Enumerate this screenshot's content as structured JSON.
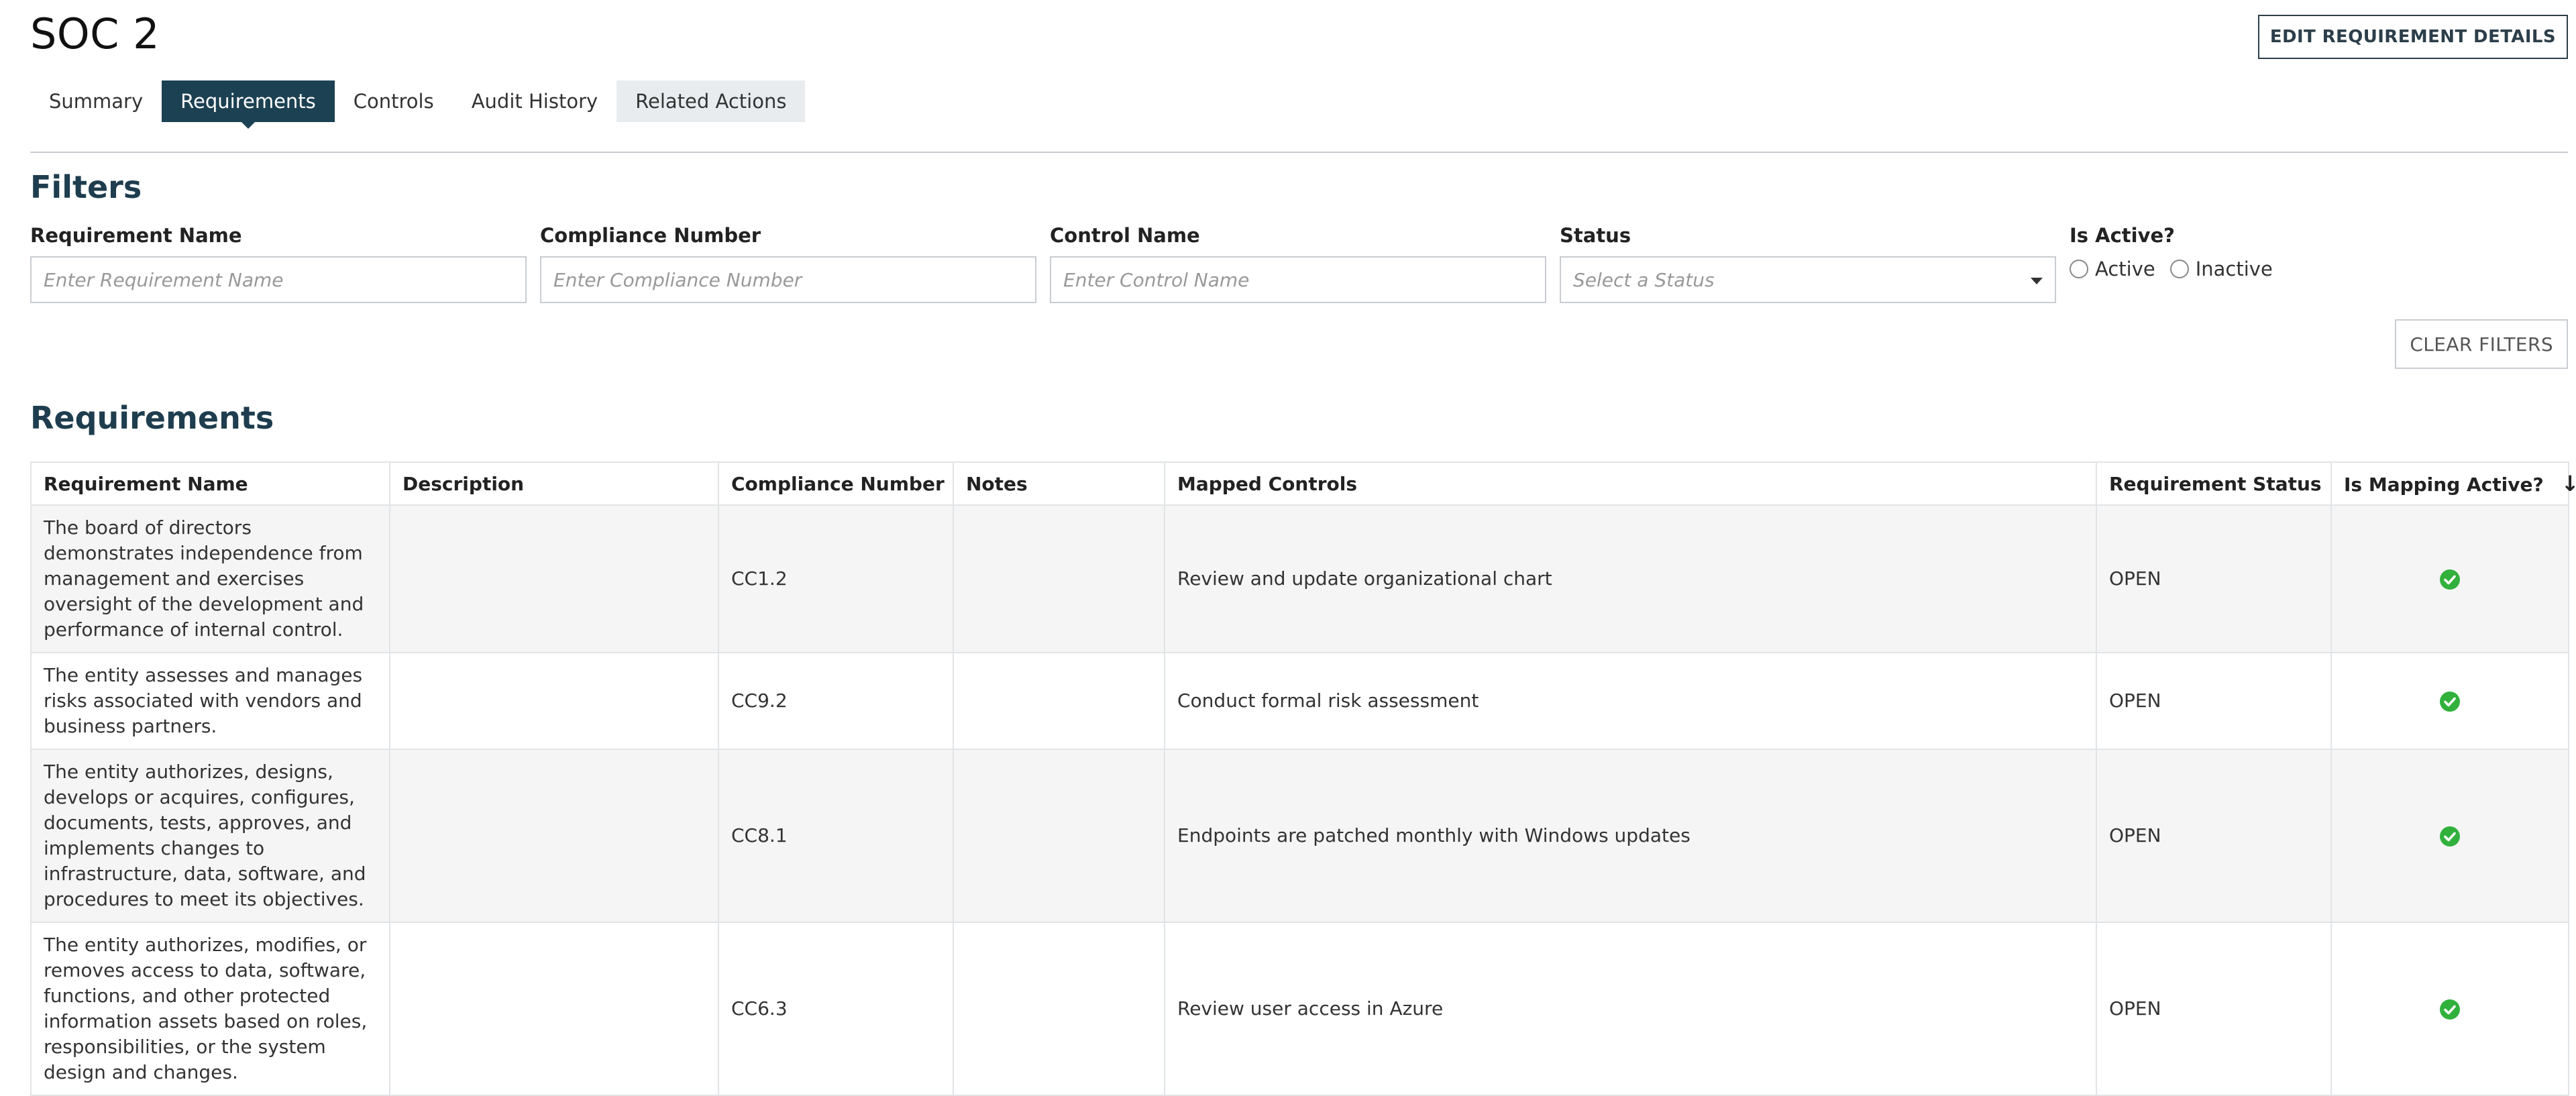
{
  "page": {
    "title": "SOC 2",
    "edit_button": "EDIT REQUIREMENT DETAILS"
  },
  "tabs": [
    {
      "label": "Summary",
      "active": false
    },
    {
      "label": "Requirements",
      "active": true
    },
    {
      "label": "Controls",
      "active": false
    },
    {
      "label": "Audit History",
      "active": false
    },
    {
      "label": "Related Actions",
      "active": false
    }
  ],
  "filters": {
    "title": "Filters",
    "requirement_name": {
      "label": "Requirement Name",
      "placeholder": "Enter Requirement Name"
    },
    "compliance_number": {
      "label": "Compliance Number",
      "placeholder": "Enter Compliance Number"
    },
    "control_name": {
      "label": "Control Name",
      "placeholder": "Enter Control Name"
    },
    "status": {
      "label": "Status",
      "placeholder": "Select a Status"
    },
    "is_active": {
      "label": "Is Active?",
      "options": [
        "Active",
        "Inactive"
      ]
    },
    "clear_button": "CLEAR FILTERS"
  },
  "requirements": {
    "title": "Requirements",
    "columns": [
      "Requirement Name",
      "Description",
      "Compliance Number",
      "Notes",
      "Mapped Controls",
      "Requirement Status",
      "Is Mapping Active?"
    ],
    "rows": [
      {
        "name": "The board of directors demonstrates independence from management and exercises oversight of the development and performance of internal control.",
        "description": "",
        "compliance_number": "CC1.2",
        "notes": "",
        "mapped_controls": "Review and update organizational chart",
        "status": "OPEN",
        "mapping_active": true
      },
      {
        "name": "The entity assesses and manages risks associated with vendors and business partners.",
        "description": "",
        "compliance_number": "CC9.2",
        "notes": "",
        "mapped_controls": "Conduct formal risk assessment",
        "status": "OPEN",
        "mapping_active": true
      },
      {
        "name": "The entity authorizes, designs, develops or acquires, configures, documents, tests, approves, and implements changes to infrastructure, data, software, and procedures to meet its objectives.",
        "description": "",
        "compliance_number": "CC8.1",
        "notes": "",
        "mapped_controls": "Endpoints are patched monthly with Windows updates",
        "status": "OPEN",
        "mapping_active": true
      },
      {
        "name": "The entity authorizes, modifies, or removes access to data, software, functions, and other protected information assets based on roles, responsibilities, or the system design and changes.",
        "description": "",
        "compliance_number": "CC6.3",
        "notes": "",
        "mapped_controls": "Review user access in Azure",
        "status": "OPEN",
        "mapping_active": true
      }
    ]
  },
  "icons": {
    "sort": "arrow-down-icon",
    "check": "check-circle-icon",
    "check_color": "#31b13c",
    "accent": "#1c4152"
  }
}
